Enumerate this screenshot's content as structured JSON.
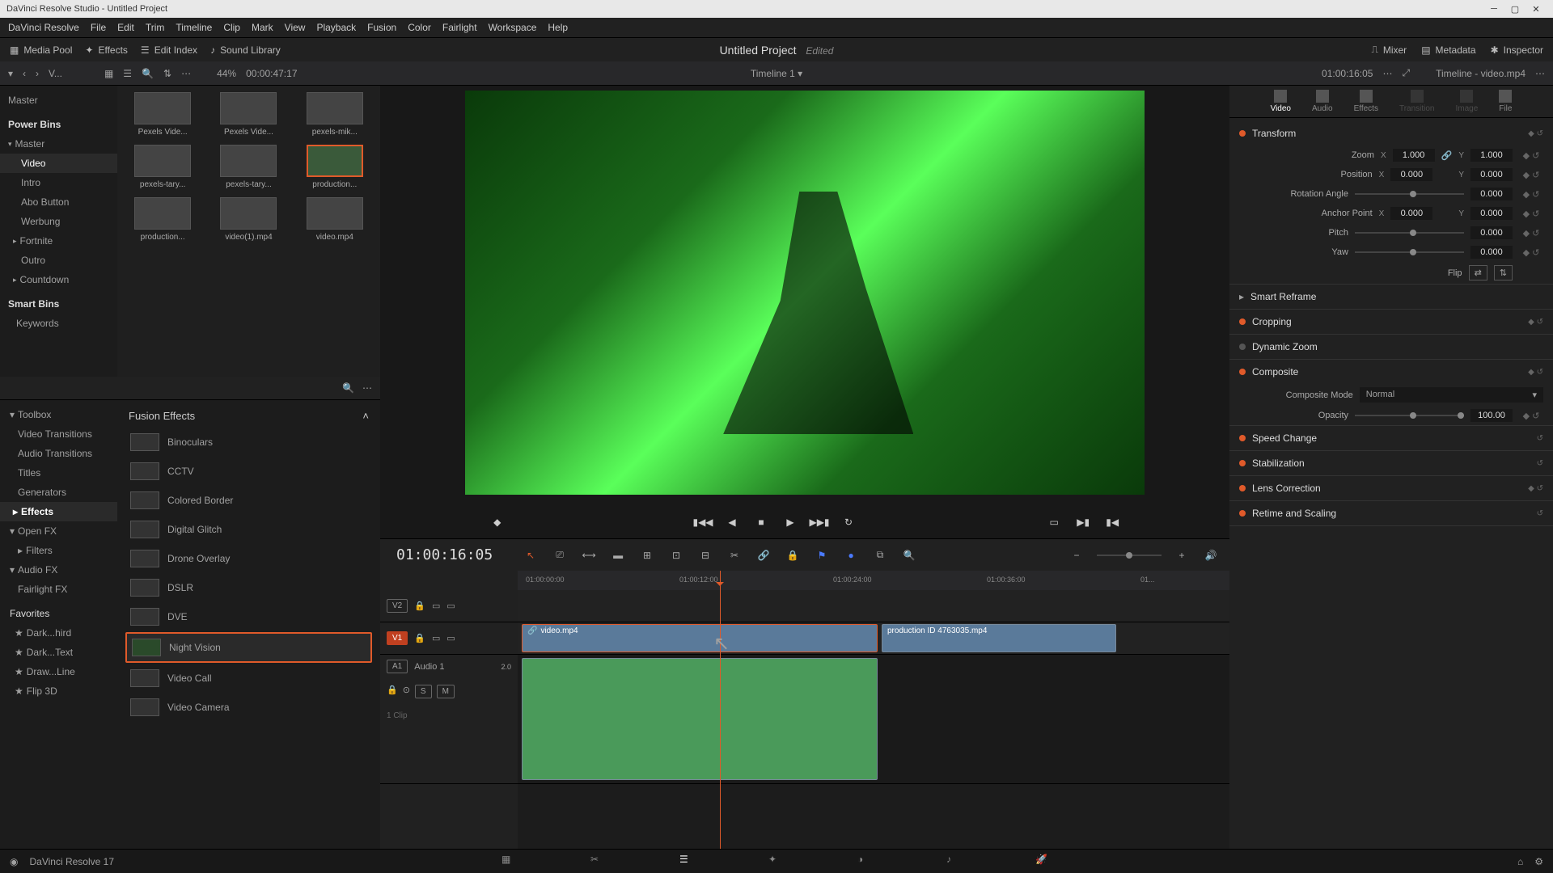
{
  "app": {
    "title": "DaVinci Resolve Studio - Untitled Project",
    "version": "DaVinci Resolve 17"
  },
  "menubar": [
    "DaVinci Resolve",
    "File",
    "Edit",
    "Trim",
    "Timeline",
    "Clip",
    "Mark",
    "View",
    "Playback",
    "Fusion",
    "Color",
    "Fairlight",
    "Workspace",
    "Help"
  ],
  "toolbar": {
    "media_pool": "Media Pool",
    "effects": "Effects",
    "edit_index": "Edit Index",
    "sound_library": "Sound Library",
    "mixer": "Mixer",
    "metadata": "Metadata",
    "inspector": "Inspector"
  },
  "project": {
    "title": "Untitled Project",
    "edited": "Edited"
  },
  "secondary": {
    "view_label": "V...",
    "zoom_pct": "44%",
    "tc_source": "00:00:47:17",
    "timeline_name": "Timeline 1",
    "tc_record": "01:00:16:05",
    "inspector_label": "Timeline - video.mp4"
  },
  "folders": {
    "master": "Master",
    "power_bins": "Power Bins",
    "items": [
      "Master",
      "Video",
      "Intro",
      "Abo Button",
      "Werbung",
      "Fortnite",
      "Outro",
      "Countdown"
    ],
    "smart_bins": "Smart Bins",
    "keywords": "Keywords"
  },
  "media": [
    {
      "label": "Pexels Vide..."
    },
    {
      "label": "Pexels Vide..."
    },
    {
      "label": "pexels-mik..."
    },
    {
      "label": "pexels-tary..."
    },
    {
      "label": "pexels-tary..."
    },
    {
      "label": "production...",
      "selected": true
    },
    {
      "label": "production..."
    },
    {
      "label": "video(1).mp4"
    },
    {
      "label": "video.mp4"
    }
  ],
  "effects_tree": {
    "toolbox": "Toolbox",
    "items": [
      "Video Transitions",
      "Audio Transitions",
      "Titles",
      "Generators",
      "Effects"
    ],
    "open_fx": "Open FX",
    "filters": "Filters",
    "audio_fx": "Audio FX",
    "fairlight_fx": "Fairlight FX",
    "favorites": "Favorites",
    "fav_items": [
      "Dark...hird",
      "Dark...Text",
      "Draw...Line",
      "Flip 3D"
    ]
  },
  "fusion_effects": {
    "header": "Fusion Effects",
    "items": [
      "Binoculars",
      "CCTV",
      "Colored Border",
      "Digital Glitch",
      "Drone Overlay",
      "DSLR",
      "DVE",
      "Night Vision",
      "Video Call",
      "Video Camera"
    ],
    "selected_index": 7
  },
  "timeline": {
    "tc": "01:00:16:05",
    "ruler": [
      "01:00:00:00",
      "01:00:12:00",
      "01:00:24:00",
      "01:00:36:00",
      "01..."
    ],
    "tracks": {
      "v2": "V2",
      "v1": "V1",
      "a1": "A1",
      "a1_name": "Audio 1",
      "a1_level": "2.0",
      "a1_clips": "1 Clip"
    },
    "clips": {
      "v1a": "video.mp4",
      "v1b": "production ID 4763035.mp4"
    }
  },
  "inspector": {
    "tabs": [
      "Video",
      "Audio",
      "Effects",
      "Transition",
      "Image",
      "File"
    ],
    "active_tab": 0,
    "transform": {
      "title": "Transform",
      "zoom": "Zoom",
      "zoom_x": "1.000",
      "zoom_y": "1.000",
      "position": "Position",
      "pos_x": "0.000",
      "pos_y": "0.000",
      "rotation": "Rotation Angle",
      "rot_val": "0.000",
      "anchor": "Anchor Point",
      "anch_x": "0.000",
      "anch_y": "0.000",
      "pitch": "Pitch",
      "pitch_val": "0.000",
      "yaw": "Yaw",
      "yaw_val": "0.000",
      "flip": "Flip"
    },
    "sections": [
      "Smart Reframe",
      "Cropping",
      "Dynamic Zoom",
      "Composite",
      "Speed Change",
      "Stabilization",
      "Lens Correction",
      "Retime and Scaling"
    ],
    "composite": {
      "mode_label": "Composite Mode",
      "mode_value": "Normal",
      "opacity_label": "Opacity",
      "opacity_value": "100.00"
    }
  }
}
